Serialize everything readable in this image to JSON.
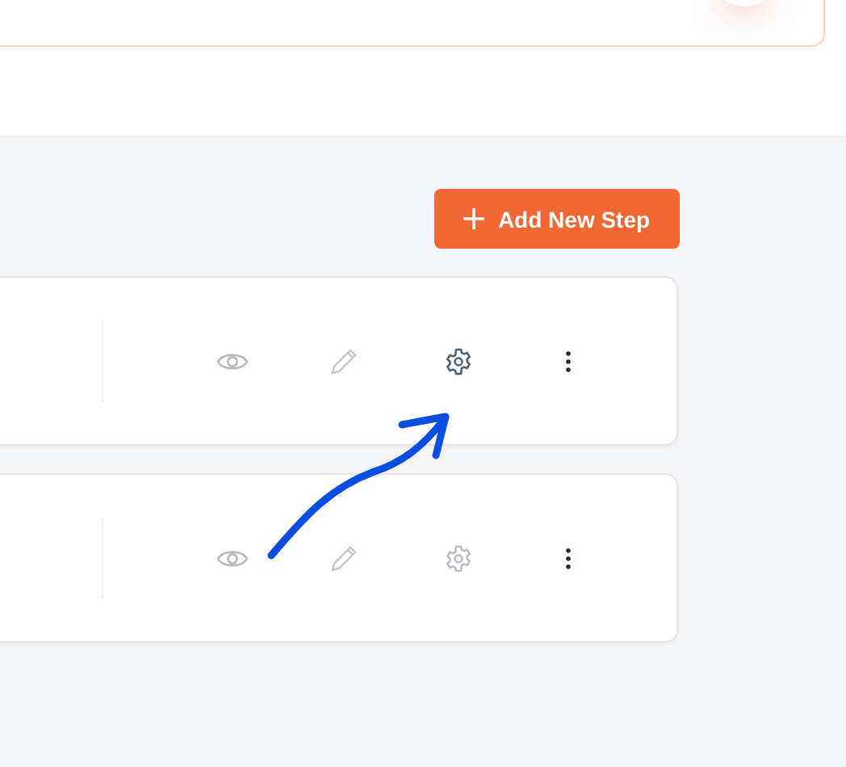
{
  "toolbar": {
    "add_button": {
      "label": "Add New Step"
    }
  },
  "steps": [
    {
      "settings_highlighted": true
    },
    {
      "settings_highlighted": false
    }
  ]
}
